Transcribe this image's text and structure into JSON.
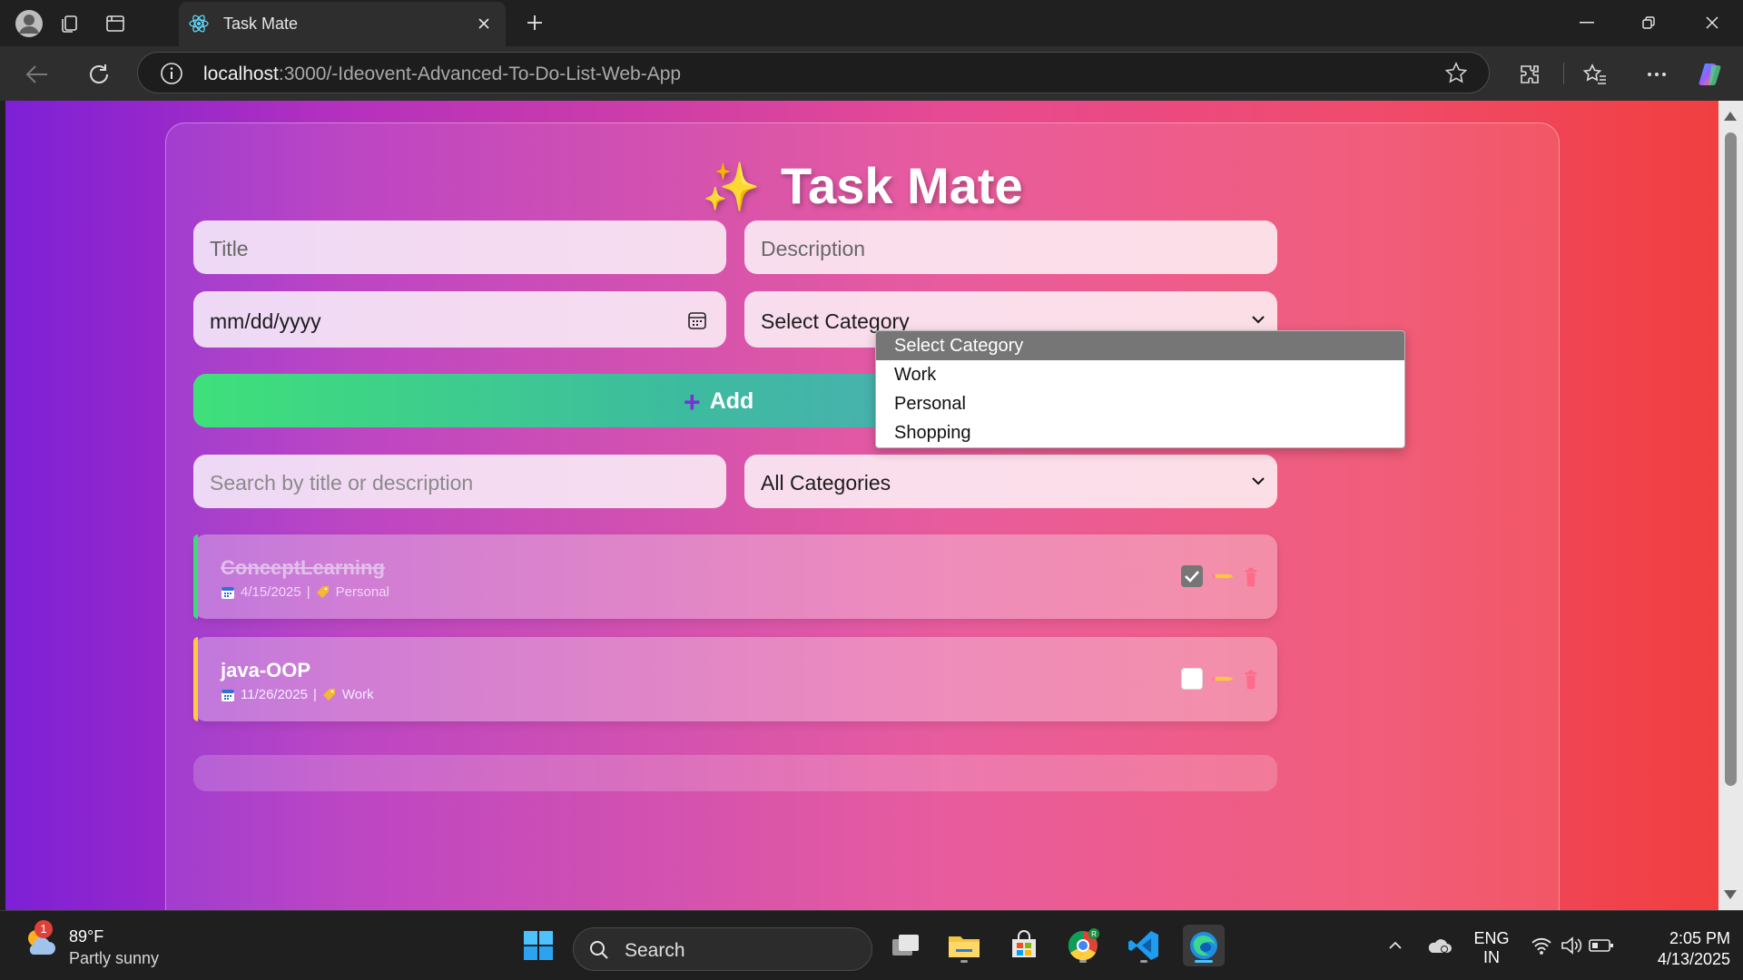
{
  "browser": {
    "tab_title": "Task Mate",
    "url_host": "localhost",
    "url_path": ":3000/-Ideovent-Advanced-To-Do-List-Web-App"
  },
  "app": {
    "title_icon": "✨",
    "title": "Task Mate",
    "form": {
      "title_placeholder": "Title",
      "description_placeholder": "Description",
      "date_placeholder": "mm/dd/yyyy",
      "category_selected": "Select Category",
      "add_button_label": "Add"
    },
    "category_dropdown": {
      "options": [
        "Select Category",
        "Work",
        "Personal",
        "Shopping"
      ],
      "highlighted": "Select Category"
    },
    "filters": {
      "search_placeholder": "Search by title or description",
      "category_filter": "All Categories"
    },
    "tasks": [
      {
        "title": "ConceptLearning",
        "date": "4/15/2025",
        "separator": "|",
        "category": "Personal",
        "completed": true,
        "accent": "#3dd97a"
      },
      {
        "title": "java-OOP",
        "date": "11/26/2025",
        "separator": "|",
        "category": "Work",
        "completed": false,
        "accent": "#ffc83d"
      }
    ]
  },
  "taskbar": {
    "weather_temp": "89°F",
    "weather_cond": "Partly sunny",
    "weather_badge": "1",
    "search_label": "Search",
    "lang_top": "ENG",
    "lang_bottom": "IN",
    "time": "2:05 PM",
    "date": "4/13/2025"
  }
}
